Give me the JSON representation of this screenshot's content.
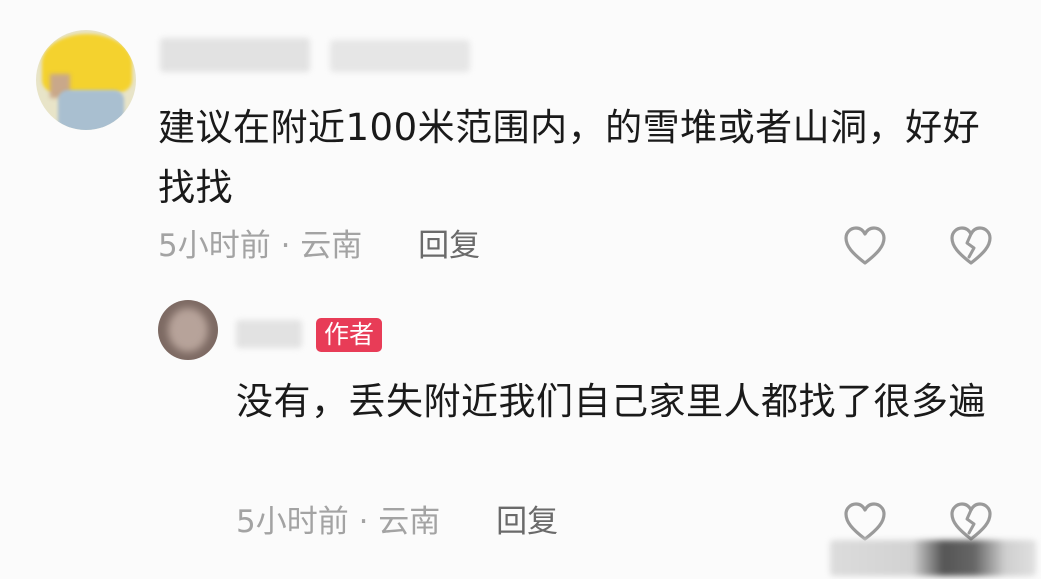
{
  "comments": [
    {
      "text": "建议在附近100米范围内，的雪堆或者山洞，好好找找",
      "time_location": "5小时前 · 云南",
      "reply_label": "回复"
    }
  ],
  "reply": {
    "badge": "作者",
    "text": "没有，丢失附近我们自己家里人都找了很多遍",
    "time_location": "5小时前 · 云南",
    "reply_label": "回复"
  },
  "colors": {
    "badge_bg": "#e83c57",
    "meta_text": "#a3a3a3",
    "body_text": "#1a1a1a"
  },
  "icons": {
    "like": "heart-outline-icon",
    "dislike": "broken-heart-outline-icon"
  }
}
